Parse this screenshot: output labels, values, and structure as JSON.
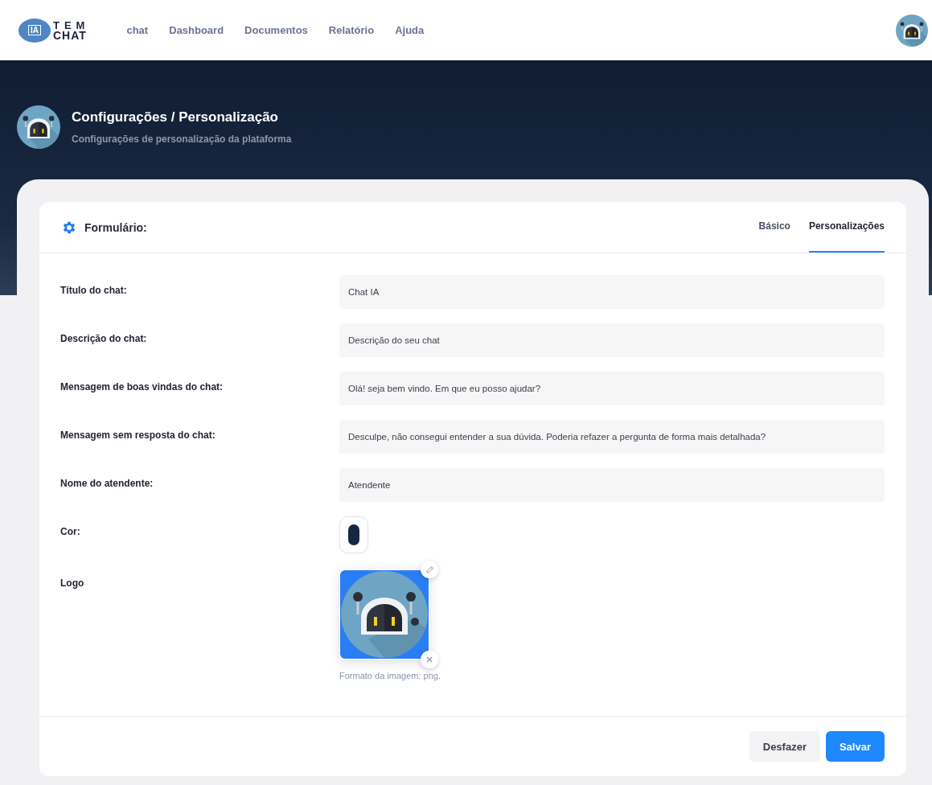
{
  "brand": {
    "badge": "IA",
    "line1": "TEM",
    "line2": "CHAT"
  },
  "nav": [
    {
      "label": "chat"
    },
    {
      "label": "Dashboard"
    },
    {
      "label": "Documentos"
    },
    {
      "label": "Relatório"
    },
    {
      "label": "Ajuda"
    }
  ],
  "page_header": {
    "title": "Configurações / Personalização",
    "subtitle": "Configurações de personalização da plataforma"
  },
  "card": {
    "title": "Formulário:",
    "tabs": [
      {
        "label": "Básico",
        "selected": false
      },
      {
        "label": "Personalizações",
        "selected": true
      }
    ],
    "fields": [
      {
        "kind": "text",
        "label": "Título do chat:",
        "value": "Chat IA"
      },
      {
        "kind": "text",
        "label": "Descrição do chat:",
        "value": "Descrição do seu chat"
      },
      {
        "kind": "text",
        "label": "Mensagem de boas vindas do chat:",
        "value": "Olá! seja bem vindo. Em que eu posso ajudar?"
      },
      {
        "kind": "text",
        "label": "Mensagem sem resposta do chat:",
        "value": "Desculpe, não consegui entender a sua dúvida. Poderia refazer a pergunta de forma mais detalhada?"
      },
      {
        "kind": "text",
        "label": "Nome do atendente:",
        "value": "Atendente"
      },
      {
        "kind": "color",
        "label": "Cor:",
        "color": "#16283f"
      },
      {
        "kind": "image",
        "label": "Logo",
        "hint": "Formato da imagem: png."
      }
    ],
    "buttons": [
      {
        "kind": "secondary",
        "label": "Desfazer"
      },
      {
        "kind": "primary",
        "label": "Salvar"
      }
    ]
  }
}
